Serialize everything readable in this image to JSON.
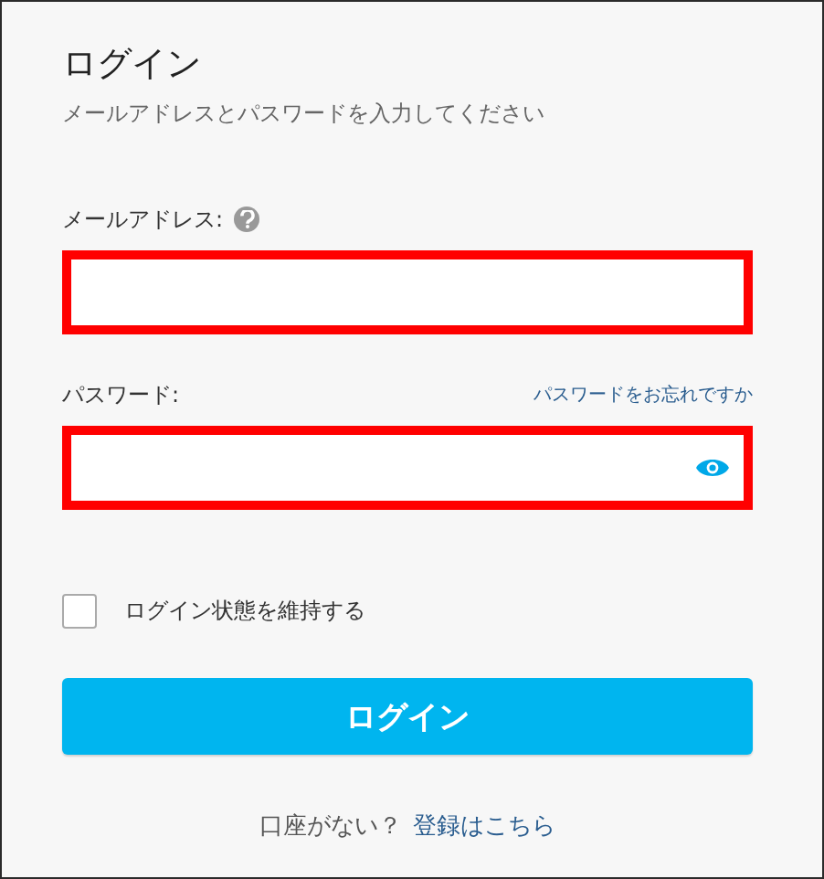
{
  "title": "ログイン",
  "subtitle": "メールアドレスとパスワードを入力してください",
  "email": {
    "label": "メールアドレス:",
    "highlighted": true
  },
  "password": {
    "label": "パスワード:",
    "forgot_link": "パスワードをお忘れですか",
    "highlighted": true
  },
  "remember": {
    "label": "ログイン状態を維持する",
    "checked": false
  },
  "submit": "ログイン",
  "footer": {
    "text": "口座がない？",
    "link": "登録はこちら"
  }
}
